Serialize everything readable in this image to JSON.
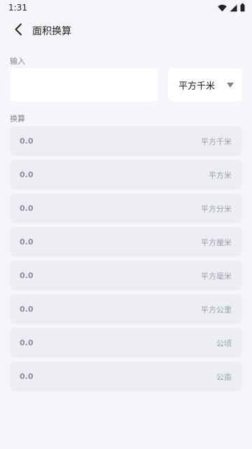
{
  "status_bar": {
    "time": "1:31"
  },
  "header": {
    "title": "面积换算",
    "back_icon": "chevron-left-icon"
  },
  "input_section": {
    "label": "输入",
    "input_value": "",
    "input_placeholder": "",
    "selected_unit": "平方千米",
    "dropdown_icon": "triangle-down-icon"
  },
  "result_section": {
    "label": "换算",
    "rows": [
      {
        "value": "0.0",
        "unit": "平方千米"
      },
      {
        "value": "0.0",
        "unit": "平方米"
      },
      {
        "value": "0.0",
        "unit": "平方分米"
      },
      {
        "value": "0.0",
        "unit": "平方厘米"
      },
      {
        "value": "0.0",
        "unit": "平方毫米"
      },
      {
        "value": "0.0",
        "unit": "平方公里"
      },
      {
        "value": "0.0",
        "unit": "公顷"
      },
      {
        "value": "0.0",
        "unit": "公亩"
      }
    ]
  },
  "colors": {
    "background": "#f5f6fa",
    "card": "#ffffff",
    "row": "#eceef4",
    "muted_text": "#8a8ea0",
    "dropdown_icon": "#7b8296"
  }
}
